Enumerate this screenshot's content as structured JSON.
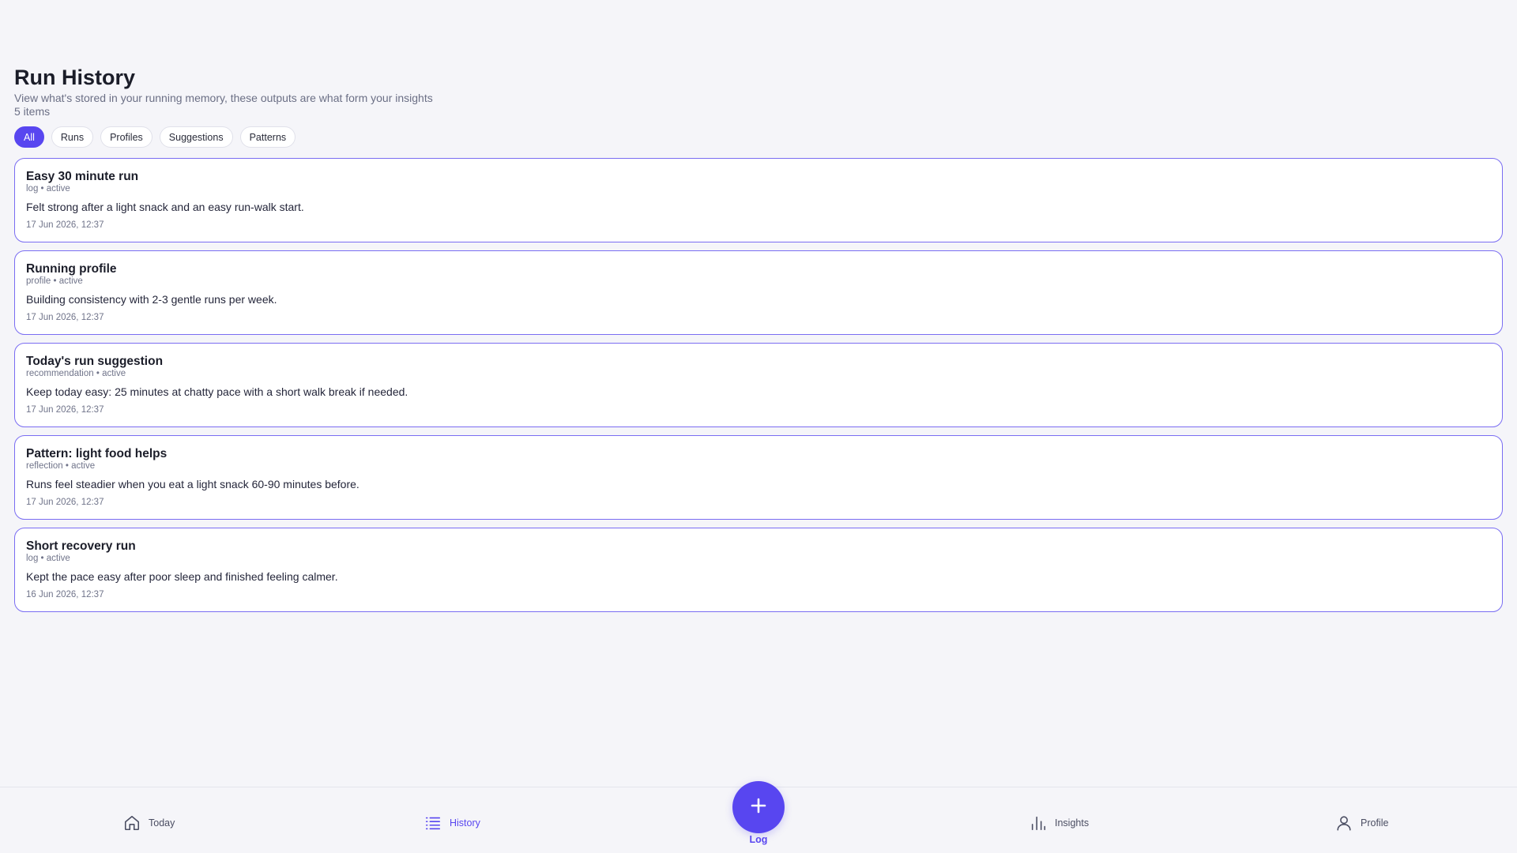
{
  "header": {
    "title": "Run History",
    "subtitle": "View what's stored in your running memory, these outputs are what form your insights",
    "count": "5 items"
  },
  "filters": [
    {
      "label": "All",
      "active": true
    },
    {
      "label": "Runs",
      "active": false
    },
    {
      "label": "Profiles",
      "active": false
    },
    {
      "label": "Suggestions",
      "active": false
    },
    {
      "label": "Patterns",
      "active": false
    }
  ],
  "items": [
    {
      "title": "Easy 30 minute run",
      "meta": "log • active",
      "body": "Felt strong after a light snack and an easy run-walk start.",
      "date": "17 Jun 2026, 12:37"
    },
    {
      "title": "Running profile",
      "meta": "profile • active",
      "body": "Building consistency with 2-3 gentle runs per week.",
      "date": "17 Jun 2026, 12:37"
    },
    {
      "title": "Today's run suggestion",
      "meta": "recommendation • active",
      "body": "Keep today easy: 25 minutes at chatty pace with a short walk break if needed.",
      "date": "17 Jun 2026, 12:37"
    },
    {
      "title": "Pattern: light food helps",
      "meta": "reflection • active",
      "body": "Runs feel steadier when you eat a light snack 60-90 minutes before.",
      "date": "17 Jun 2026, 12:37"
    },
    {
      "title": "Short recovery run",
      "meta": "log • active",
      "body": "Kept the pace easy after poor sleep and finished feeling calmer.",
      "date": "16 Jun 2026, 12:37"
    }
  ],
  "nav": {
    "today": "Today",
    "history": "History",
    "log": "Log",
    "insights": "Insights",
    "profile": "Profile",
    "active": "history"
  },
  "colors": {
    "accent": "#5846f0",
    "card_border": "#7a6df2",
    "background": "#f5f5f9"
  }
}
